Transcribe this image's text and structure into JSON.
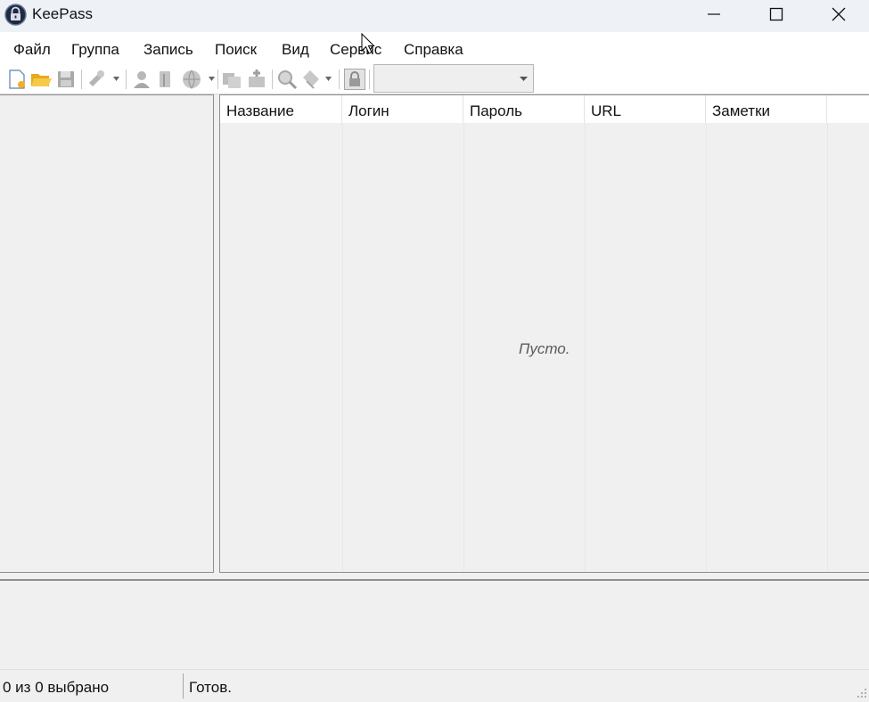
{
  "window": {
    "title": "KeePass",
    "icon": "keepass-lock-icon"
  },
  "menu": {
    "items": [
      {
        "label": "Файл"
      },
      {
        "label": "Группа"
      },
      {
        "label": "Запись"
      },
      {
        "label": "Поиск"
      },
      {
        "label": "Вид"
      },
      {
        "label": "Сервис"
      },
      {
        "label": "Справка"
      }
    ]
  },
  "toolbar": {
    "icons": [
      "new-database-icon",
      "open-database-icon",
      "save-icon",
      "add-entry-icon",
      "edit-entry-icon",
      "copy-username-icon",
      "copy-password-icon",
      "open-url-icon",
      "autotype-icon",
      "find-icon",
      "tag-filter-icon",
      "lock-icon"
    ],
    "quick_find_value": ""
  },
  "entries": {
    "columns": [
      "Название",
      "Логин",
      "Пароль",
      "URL",
      "Заметки"
    ],
    "rows": [],
    "empty_text": "Пусто."
  },
  "status": {
    "selection": "0 из 0 выбрано",
    "state": "Готов."
  },
  "colors": {
    "title_bar": "#eef2f7",
    "pane_background": "#f0f0f0",
    "pane_border": "#8e8e8e"
  }
}
